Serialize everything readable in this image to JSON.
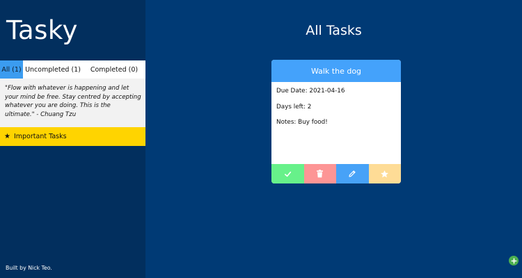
{
  "app": {
    "logo": "Tasky",
    "credit": "Built by Nick Teo."
  },
  "tabs": [
    {
      "label": "All (1)",
      "active": true
    },
    {
      "label": "Uncompleted (1)",
      "active": false
    },
    {
      "label": "Completed (0)",
      "active": false
    }
  ],
  "quote": {
    "text": "\"Flow with whatever is happening and let your mind be free. Stay centred by accepting whatever you are doing. This is the ultimate.\" - Chuang Tzu"
  },
  "important": {
    "label": "Important Tasks",
    "icon": "star-icon"
  },
  "main": {
    "title": "All Tasks"
  },
  "card": {
    "title": "Walk the dog",
    "due_date": "Due Date: 2021-04-16",
    "days_left": "Days left: 2",
    "notes": "Notes: Buy food!",
    "actions": [
      {
        "name": "complete",
        "icon": "check-icon",
        "color": "#67f18a"
      },
      {
        "name": "delete",
        "icon": "trash-icon",
        "color": "#fd9595"
      },
      {
        "name": "edit",
        "icon": "pencil-icon",
        "color": "#47a2f7"
      },
      {
        "name": "important",
        "icon": "star-icon",
        "color": "#fedc96"
      }
    ]
  },
  "colors": {
    "background": "#003a75",
    "sidebar": "#022f5e",
    "accent": "#44a2fb",
    "important": "#ffd400",
    "add": "#4caf50"
  }
}
